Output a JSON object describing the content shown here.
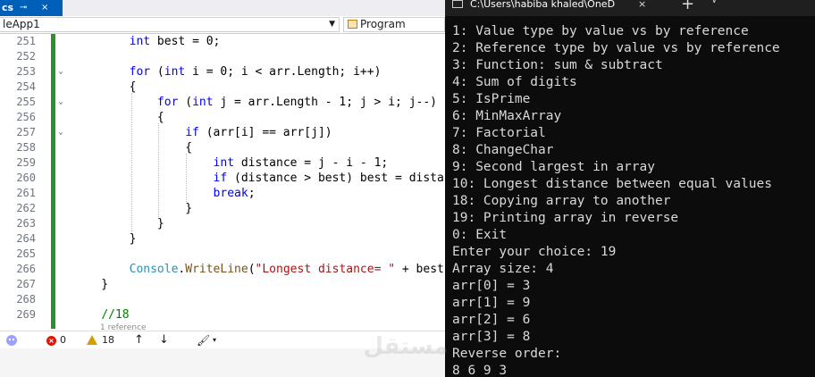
{
  "ide": {
    "tab_label": "cs",
    "tab_pin": "⊸",
    "tab_close": "×",
    "nav_project": "leApp1",
    "nav_class": "Program",
    "lines": [
      {
        "num": "251",
        "code": [
          {
            "t": "        "
          },
          {
            "t": "int",
            "c": "kw"
          },
          {
            "t": " best = 0;"
          }
        ]
      },
      {
        "num": "252",
        "code": []
      },
      {
        "num": "253",
        "fold": true,
        "code": [
          {
            "t": "        "
          },
          {
            "t": "for",
            "c": "kw"
          },
          {
            "t": " ("
          },
          {
            "t": "int",
            "c": "kw"
          },
          {
            "t": " i = 0; i < arr.Length; i++)"
          }
        ]
      },
      {
        "num": "254",
        "code": [
          {
            "t": "        {"
          }
        ]
      },
      {
        "num": "255",
        "fold": true,
        "code": [
          {
            "t": "            "
          },
          {
            "t": "for",
            "c": "kw"
          },
          {
            "t": " ("
          },
          {
            "t": "int",
            "c": "kw"
          },
          {
            "t": " j = arr.Length - 1; j > i; j--)"
          }
        ]
      },
      {
        "num": "256",
        "code": [
          {
            "t": "            {"
          }
        ]
      },
      {
        "num": "257",
        "fold": true,
        "code": [
          {
            "t": "                "
          },
          {
            "t": "if",
            "c": "kw"
          },
          {
            "t": " (arr[i] == arr[j])"
          }
        ]
      },
      {
        "num": "258",
        "code": [
          {
            "t": "                {"
          }
        ]
      },
      {
        "num": "259",
        "code": [
          {
            "t": "                    "
          },
          {
            "t": "int",
            "c": "kw"
          },
          {
            "t": " distance = j - i - 1;"
          }
        ]
      },
      {
        "num": "260",
        "code": [
          {
            "t": "                    "
          },
          {
            "t": "if",
            "c": "kw"
          },
          {
            "t": " (distance > best) best = distance;"
          }
        ]
      },
      {
        "num": "261",
        "code": [
          {
            "t": "                    "
          },
          {
            "t": "break",
            "c": "kw"
          },
          {
            "t": ";"
          }
        ]
      },
      {
        "num": "262",
        "code": [
          {
            "t": "                }"
          }
        ]
      },
      {
        "num": "263",
        "code": [
          {
            "t": "            }"
          }
        ]
      },
      {
        "num": "264",
        "code": [
          {
            "t": "        }"
          }
        ]
      },
      {
        "num": "265",
        "code": []
      },
      {
        "num": "266",
        "code": [
          {
            "t": "        "
          },
          {
            "t": "Console",
            "c": "ty"
          },
          {
            "t": "."
          },
          {
            "t": "WriteLine",
            "c": "mth"
          },
          {
            "t": "("
          },
          {
            "t": "\"Longest distance= \"",
            "c": "str"
          },
          {
            "t": " + best);"
          }
        ]
      },
      {
        "num": "267",
        "code": [
          {
            "t": "    }"
          }
        ]
      },
      {
        "num": "268",
        "code": []
      },
      {
        "num": "269",
        "code": [
          {
            "t": "    "
          },
          {
            "t": "//18",
            "c": "cm"
          }
        ]
      }
    ],
    "references_hint": "1 reference",
    "status": {
      "zoom": "%",
      "errors": "0",
      "warnings": "18",
      "up_arrow": "↑",
      "down_arrow": "↓",
      "brush": "🖌",
      "more": "▾"
    }
  },
  "terminal": {
    "title": "C:\\Users\\habiba khaled\\OneD",
    "close": "×",
    "add": "+",
    "dropdown": "∨",
    "lines": [
      "1: Value type by value vs by reference",
      "2: Reference type by value vs by reference",
      "3: Function: sum & subtract",
      "4: Sum of digits",
      "5: IsPrime",
      "6: MinMaxArray",
      "7: Factorial",
      "8: ChangeChar",
      "9: Second largest in array",
      "10: Longest distance between equal values",
      "18: Copying array to another",
      "19: Printing array in reverse",
      "0: Exit",
      "Enter your choice: 19",
      "Array size: 4",
      "arr[0] = 3",
      "arr[1] = 9",
      "arr[2] = 6",
      "arr[3] = 8",
      "Reverse order:",
      "8 6 9 3"
    ]
  },
  "watermark_text": "مستقل",
  "colors": {
    "accent": "#005fb8",
    "terminal_bg": "#0c0c0c",
    "terminal_fg": "#d9d9d9",
    "keyword": "#0000ff",
    "type": "#2b91af",
    "string": "#a31515",
    "comment": "#008000",
    "change_bar": "#2f8f2f"
  }
}
